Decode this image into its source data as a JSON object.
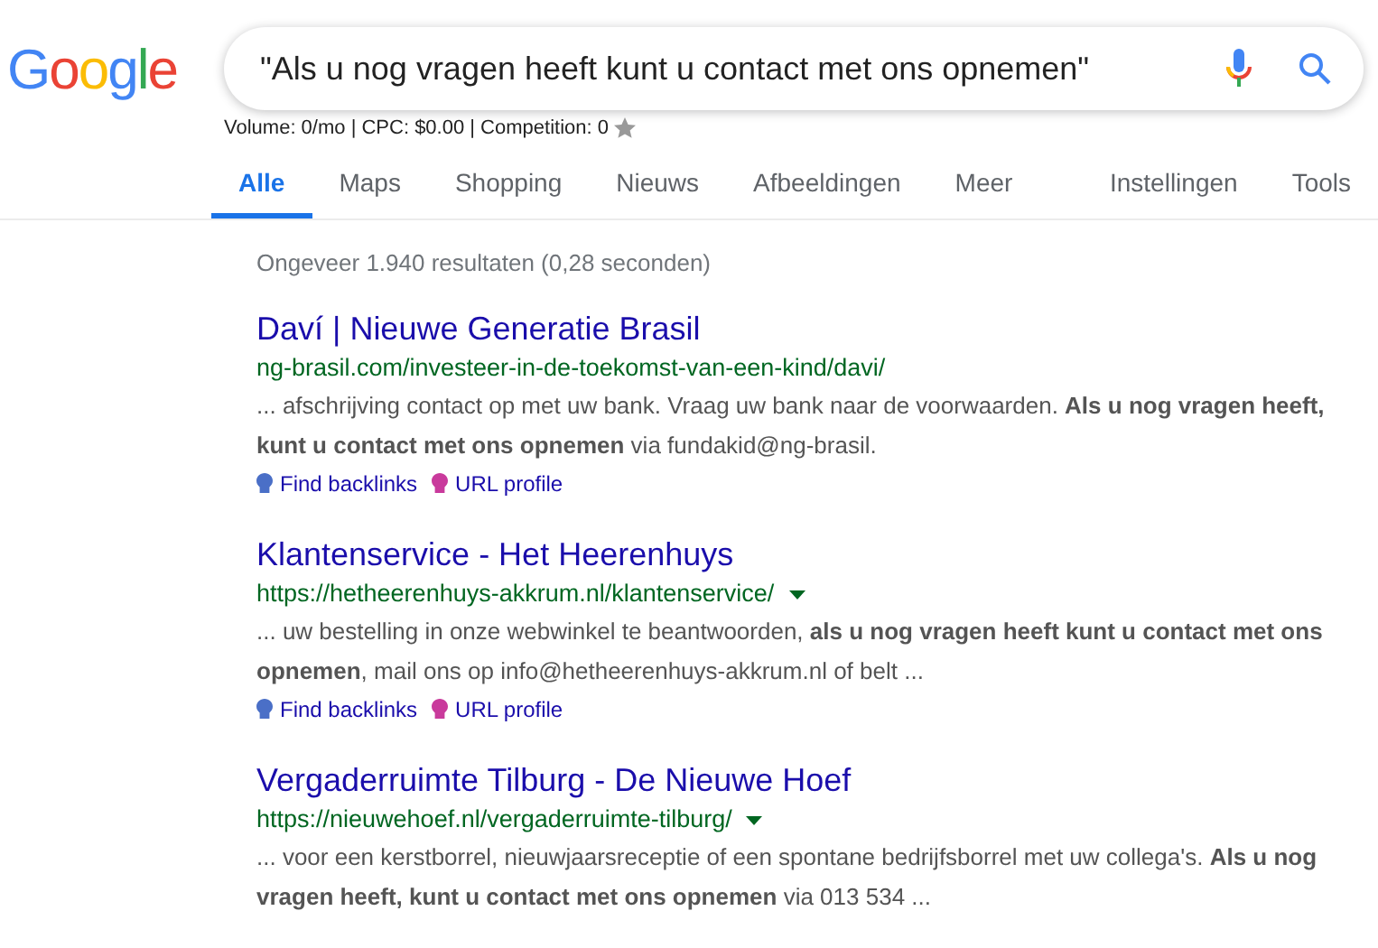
{
  "logo": "Google",
  "search": {
    "value": "\"Als u nog vragen heeft kunt u contact met ons opnemen\""
  },
  "keyword_stats": "Volume: 0/mo | CPC: $0.00 | Competition: 0",
  "tabs": [
    {
      "label": "Alle",
      "selected": true
    },
    {
      "label": "Maps",
      "selected": false
    },
    {
      "label": "Shopping",
      "selected": false
    },
    {
      "label": "Nieuws",
      "selected": false
    },
    {
      "label": "Afbeeldingen",
      "selected": false
    },
    {
      "label": "Meer",
      "selected": false
    }
  ],
  "tools_tabs": [
    {
      "label": "Instellingen"
    },
    {
      "label": "Tools"
    }
  ],
  "result_stats": "Ongeveer 1.940 resultaten (0,28 seconden)",
  "results": [
    {
      "title": "Daví | Nieuwe Generatie Brasil",
      "url": "ng-brasil.com/investeer-in-de-toekomst-van-een-kind/davi/",
      "has_menu": false,
      "snippet": "... afschrijving contact op met uw bank. Vraag uw bank naar de voorwaarden. **Als u nog vragen heeft, kunt u contact met ons opnemen** via fundakid@ng-brasil.",
      "links": [
        {
          "label": "Find backlinks",
          "color": "#4a6fc7"
        },
        {
          "label": "URL profile",
          "color": "#c93a9c"
        }
      ]
    },
    {
      "title": "Klantenservice - Het Heerenhuys",
      "url": "https://hetheerenhuys-akkrum.nl/klantenservice/",
      "has_menu": true,
      "snippet": "... uw bestelling in onze webwinkel te beantwoorden, **als u nog vragen heeft kunt u contact met ons opnemen**, mail ons op info@hetheerenhuys-akkrum.nl of belt ...",
      "links": [
        {
          "label": "Find backlinks",
          "color": "#4a6fc7"
        },
        {
          "label": "URL profile",
          "color": "#c93a9c"
        }
      ]
    },
    {
      "title": "Vergaderruimte Tilburg - De Nieuwe Hoef",
      "url": "https://nieuwehoef.nl/vergaderruimte-tilburg/",
      "has_menu": true,
      "snippet": "... voor een kerstborrel, nieuwjaarsreceptie of een spontane bedrijfsborrel met uw collega's. **Als u nog vragen heeft, kunt u contact met ons opnemen** via 013 534 ..."
    }
  ]
}
